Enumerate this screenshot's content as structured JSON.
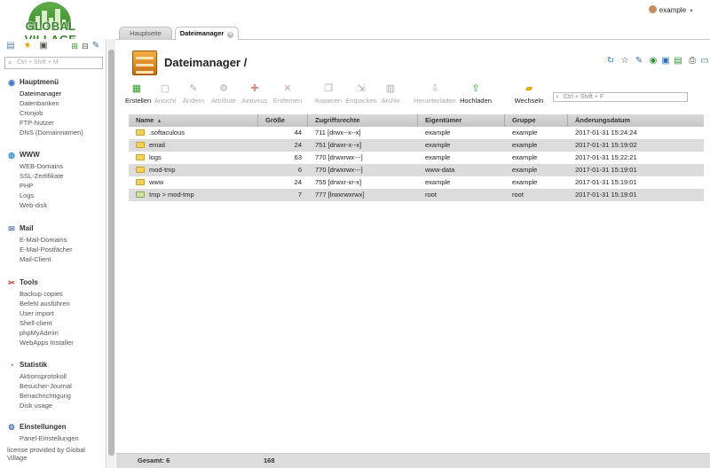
{
  "app": {
    "logo_text": "GLOBAL VILLAGE",
    "user": "example"
  },
  "sidebar": {
    "search_placeholder": "Ctrl + Shift + M",
    "groups": [
      {
        "title": "Hauptmenü",
        "icon": "globe-icon",
        "items": [
          "Dateimanager",
          "Datenbanken",
          "Cronjob",
          "FTP-Nutzer",
          "DNS (Domainnamen)"
        ]
      },
      {
        "title": "WWW",
        "icon": "world-icon",
        "items": [
          "WEB-Domains",
          "SSL-Zertifikate",
          "PHP",
          "Logs",
          "Web-disk"
        ]
      },
      {
        "title": "Mail",
        "icon": "mail-icon",
        "items": [
          "E-Mail-Domains",
          "E-Mail-Postfächer",
          "Mail-Client"
        ]
      },
      {
        "title": "Tools",
        "icon": "tools-icon",
        "items": [
          "Backup copies",
          "Befehl ausführen",
          "User import",
          "Shell-client",
          "phpMyAdmin",
          "WebApps Installer"
        ]
      },
      {
        "title": "Statistik",
        "icon": "stats-icon",
        "items": [
          "Aktionsprotokoll",
          "Besucher-Journal",
          "Benachrichtigung",
          "Disk usage"
        ]
      },
      {
        "title": "Einstellungen",
        "icon": "settings-icon",
        "items": [
          "Panel-Einstellungen"
        ]
      }
    ],
    "footer": "license provided by Global Village"
  },
  "tabs": [
    {
      "label": "Hauptseite"
    },
    {
      "label": "Dateimanager"
    }
  ],
  "page": {
    "title": "Dateimanager /"
  },
  "toolbar": {
    "buttons": [
      {
        "label": "Erstellen",
        "enabled": true
      },
      {
        "label": "Ansicht",
        "enabled": false
      },
      {
        "label": "Ändern",
        "enabled": false
      },
      {
        "label": "Attribute",
        "enabled": false
      },
      {
        "label": "Antivirus",
        "enabled": false
      },
      {
        "label": "Entfernen",
        "enabled": false
      },
      {
        "label": "Kopieren",
        "enabled": false
      },
      {
        "label": "Entpacken",
        "enabled": false
      },
      {
        "label": "Archiv",
        "enabled": false
      },
      {
        "label": "Herunterladen",
        "enabled": false
      },
      {
        "label": "Hochladen",
        "enabled": true
      },
      {
        "label": "Wechseln",
        "enabled": true
      }
    ],
    "search_placeholder": "Ctrl + Shift + F"
  },
  "table": {
    "headers": [
      "Name",
      "Größe",
      "Zugriffsrechte",
      "Eigentümer",
      "Gruppe",
      "Änderungsdatum"
    ],
    "rows": [
      {
        "name": ".softaculous",
        "size": "44",
        "perm": "711 [drwx--x--x]",
        "owner": "example",
        "group": "example",
        "date": "2017-01-31 15:24:24",
        "link": false
      },
      {
        "name": "email",
        "size": "24",
        "perm": "751 [drwxr-x--x]",
        "owner": "example",
        "group": "example",
        "date": "2017-01-31 15:19:02",
        "link": false
      },
      {
        "name": "logs",
        "size": "63",
        "perm": "770 [drwxrwx---]",
        "owner": "example",
        "group": "example",
        "date": "2017-01-31 15:22:21",
        "link": false
      },
      {
        "name": "mod-tmp",
        "size": "6",
        "perm": "770 [drwxrwx---]",
        "owner": "www-data",
        "group": "example",
        "date": "2017-01-31 15:19:01",
        "link": false
      },
      {
        "name": "www",
        "size": "24",
        "perm": "755 [drwxr-xr-x]",
        "owner": "example",
        "group": "example",
        "date": "2017-01-31 15:19:01",
        "link": false
      },
      {
        "name": "tmp > mod-tmp",
        "size": "7",
        "perm": "777 [lrwxrwxrwx]",
        "owner": "root",
        "group": "root",
        "date": "2017-01-31 15:19:01",
        "link": true
      }
    ]
  },
  "status": {
    "total_label": "Gesamt: 6",
    "total_size": "168"
  }
}
